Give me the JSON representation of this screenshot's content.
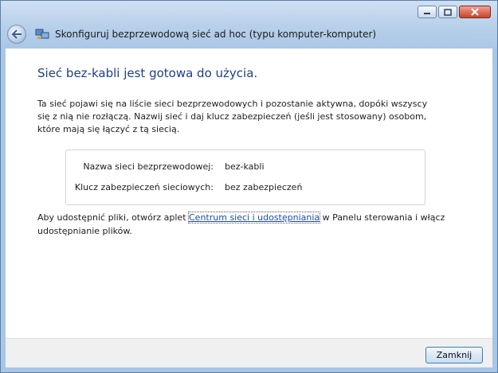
{
  "window": {
    "title": "Skonfiguruj bezprzewodową sieć ad hoc (typu komputer-komputer)",
    "caption_buttons": {
      "minimize": "minimize-icon",
      "maximize": "maximize-icon",
      "close": "close-icon"
    }
  },
  "main": {
    "heading": "Sieć bez-kabli jest gotowa do użycia.",
    "description": "Ta sieć pojawi się na liście sieci bezprzewodowych i pozostanie aktywna, dopóki wszyscy się z nią nie rozłączą. Nazwij sieć i daj klucz zabezpieczeń (jeśli jest stosowany) osobom, które mają się łączyć z tą siecią.",
    "network_info": {
      "name_label": "Nazwa sieci bezprzewodowej:",
      "name_value": "bez-kabli",
      "key_label": "Klucz zabezpieczeń sieciowych:",
      "key_value": "bez zabezpieczeń"
    },
    "share_text_before": "Aby udostępnić pliki, otwórz aplet ",
    "share_link": "Centrum sieci i udostępniania",
    "share_text_after": " w Panelu sterowania i włącz udostępnianie plików."
  },
  "footer": {
    "close_label": "Zamknij"
  },
  "colors": {
    "heading": "#1e3f88",
    "link": "#1a4ea8",
    "frame": "#a9c6e6"
  }
}
